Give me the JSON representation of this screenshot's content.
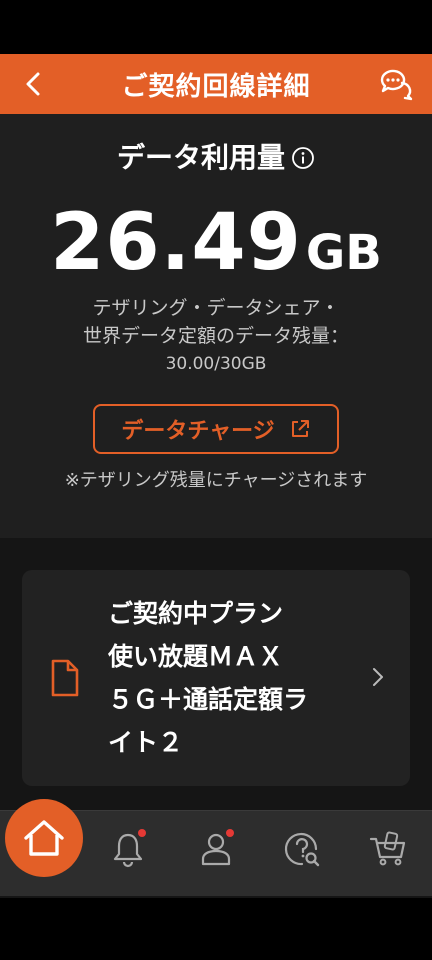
{
  "header": {
    "title": "ご契約回線詳細",
    "back_icon": "chevron-left-icon",
    "chat_icon": "chat-bubbles-icon"
  },
  "usage": {
    "label": "データ利用量",
    "value": "26.49",
    "unit": "GB",
    "desc_line1": "テザリング・データシェア・",
    "desc_line2": "世界データ定額のデータ残量：",
    "desc_line3": "30.00/30GB",
    "charge_button": "データチャージ",
    "note": "※テザリング残量にチャージされます"
  },
  "plan": {
    "line1": "ご契約中プラン",
    "line2": "使い放題ＭＡＸ",
    "line3": "５Ｇ＋通話定額ラ",
    "line4": "イト２"
  },
  "nav": {
    "items": [
      "home-icon",
      "bell-icon",
      "person-icon",
      "help-search-icon",
      "cart-icon"
    ]
  },
  "colors": {
    "accent": "#e35f27",
    "badge": "#e53935",
    "panel": "#1f1f1f",
    "card": "#222222"
  }
}
